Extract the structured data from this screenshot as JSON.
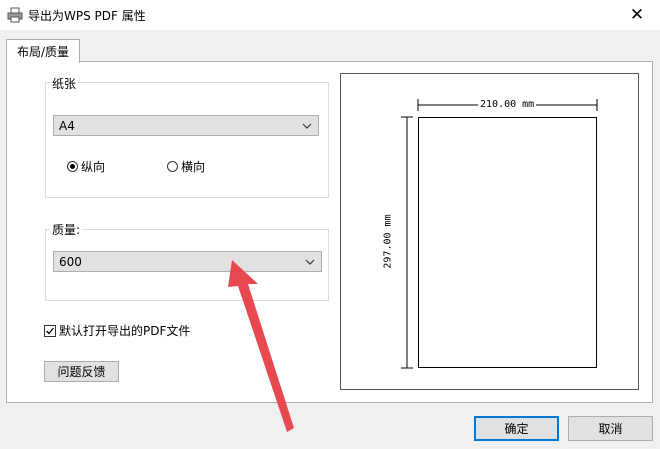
{
  "window": {
    "title": "导出为WPS PDF 属性",
    "close_glyph": "✕"
  },
  "tabs": [
    {
      "label": "布局/质量"
    }
  ],
  "paper": {
    "group_label": "纸张",
    "size_value": "A4",
    "orientation": {
      "portrait_label": "纵向",
      "landscape_label": "横向",
      "selected": "portrait"
    }
  },
  "quality": {
    "group_label": "质量:",
    "value": "600"
  },
  "open_after_export": {
    "label": "默认打开导出的PDF文件",
    "checked": true
  },
  "feedback_button": {
    "label": "问题反馈"
  },
  "preview": {
    "width_label": "210.00 mm",
    "height_label": "297.00 mm"
  },
  "footer": {
    "ok_label": "确定",
    "cancel_label": "取消"
  },
  "annotation": {
    "arrow_color": "#e8484f"
  }
}
